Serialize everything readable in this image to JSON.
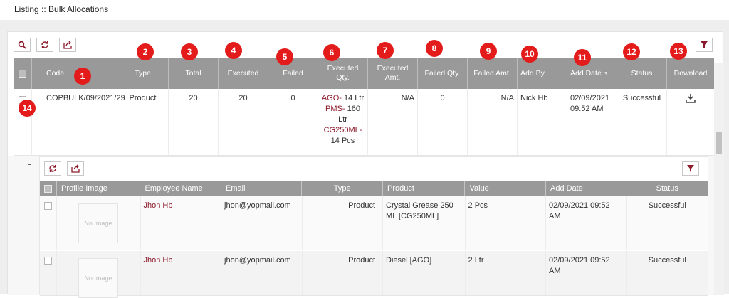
{
  "page": {
    "title": "Listing :: Bulk Allocations"
  },
  "columns": [
    {
      "key": "code",
      "label": "Code",
      "badge": "1"
    },
    {
      "key": "type",
      "label": "Type",
      "badge": "2"
    },
    {
      "key": "total",
      "label": "Total",
      "badge": "3"
    },
    {
      "key": "executed",
      "label": "Executed",
      "badge": "4"
    },
    {
      "key": "failed",
      "label": "Failed",
      "badge": "5"
    },
    {
      "key": "executed_qty",
      "label": "Executed Qty.",
      "badge": "6"
    },
    {
      "key": "executed_amt",
      "label": "Executed Amt.",
      "badge": "7"
    },
    {
      "key": "failed_qty",
      "label": "Failed Qty.",
      "badge": "8"
    },
    {
      "key": "failed_amt",
      "label": "Failed Amt.",
      "badge": "9"
    },
    {
      "key": "add_by",
      "label": "Add By",
      "badge": "10"
    },
    {
      "key": "add_date",
      "label": "Add Date",
      "badge": "11"
    },
    {
      "key": "status",
      "label": "Status",
      "badge": "12"
    },
    {
      "key": "download",
      "label": "Download",
      "badge": "13"
    }
  ],
  "expand_badge": "14",
  "main_row": {
    "code": "COPBULK/09/2021/29",
    "type": "Product",
    "total": "20",
    "executed": "20",
    "failed": "0",
    "executed_qty": [
      {
        "code": "AGO-",
        "qty": "14 Ltr"
      },
      {
        "code": "PMS-",
        "qty": "160 Ltr"
      },
      {
        "code": "CG250ML-",
        "qty": "14 Pcs"
      }
    ],
    "executed_amt": "N/A",
    "failed_qty": "0",
    "failed_amt": "N/A",
    "add_by": "Nick Hb",
    "add_date": "02/09/2021 09:52 AM",
    "status": "Successful"
  },
  "sub_columns": [
    "Profile Image",
    "Employee Name",
    "Email",
    "Type",
    "Product",
    "Value",
    "Add Date",
    "Status"
  ],
  "sub_rows": [
    {
      "image": "No Image",
      "employee": "Jhon Hb",
      "email": "jhon@yopmail.com",
      "type": "Product",
      "product": "Crystal Grease 250 ML [CG250ML]",
      "value": "2 Pcs",
      "add_date": "02/09/2021 09:52 AM",
      "status": "Successful"
    },
    {
      "image": "No Image",
      "employee": "Jhon Hb",
      "email": "jhon@yopmail.com",
      "type": "Product",
      "product": "Diesel [AGO]",
      "value": "2 Ltr",
      "add_date": "02/09/2021 09:52 AM",
      "status": "Successful"
    }
  ],
  "colors": {
    "accent": "#8b1a2b",
    "badge": "#e31b1b",
    "header": "#999999"
  },
  "icons": {
    "search": "search-icon",
    "refresh": "refresh-icon",
    "export": "export-icon",
    "filter": "filter-icon",
    "download": "download-icon",
    "expand": "collapse-icon"
  }
}
